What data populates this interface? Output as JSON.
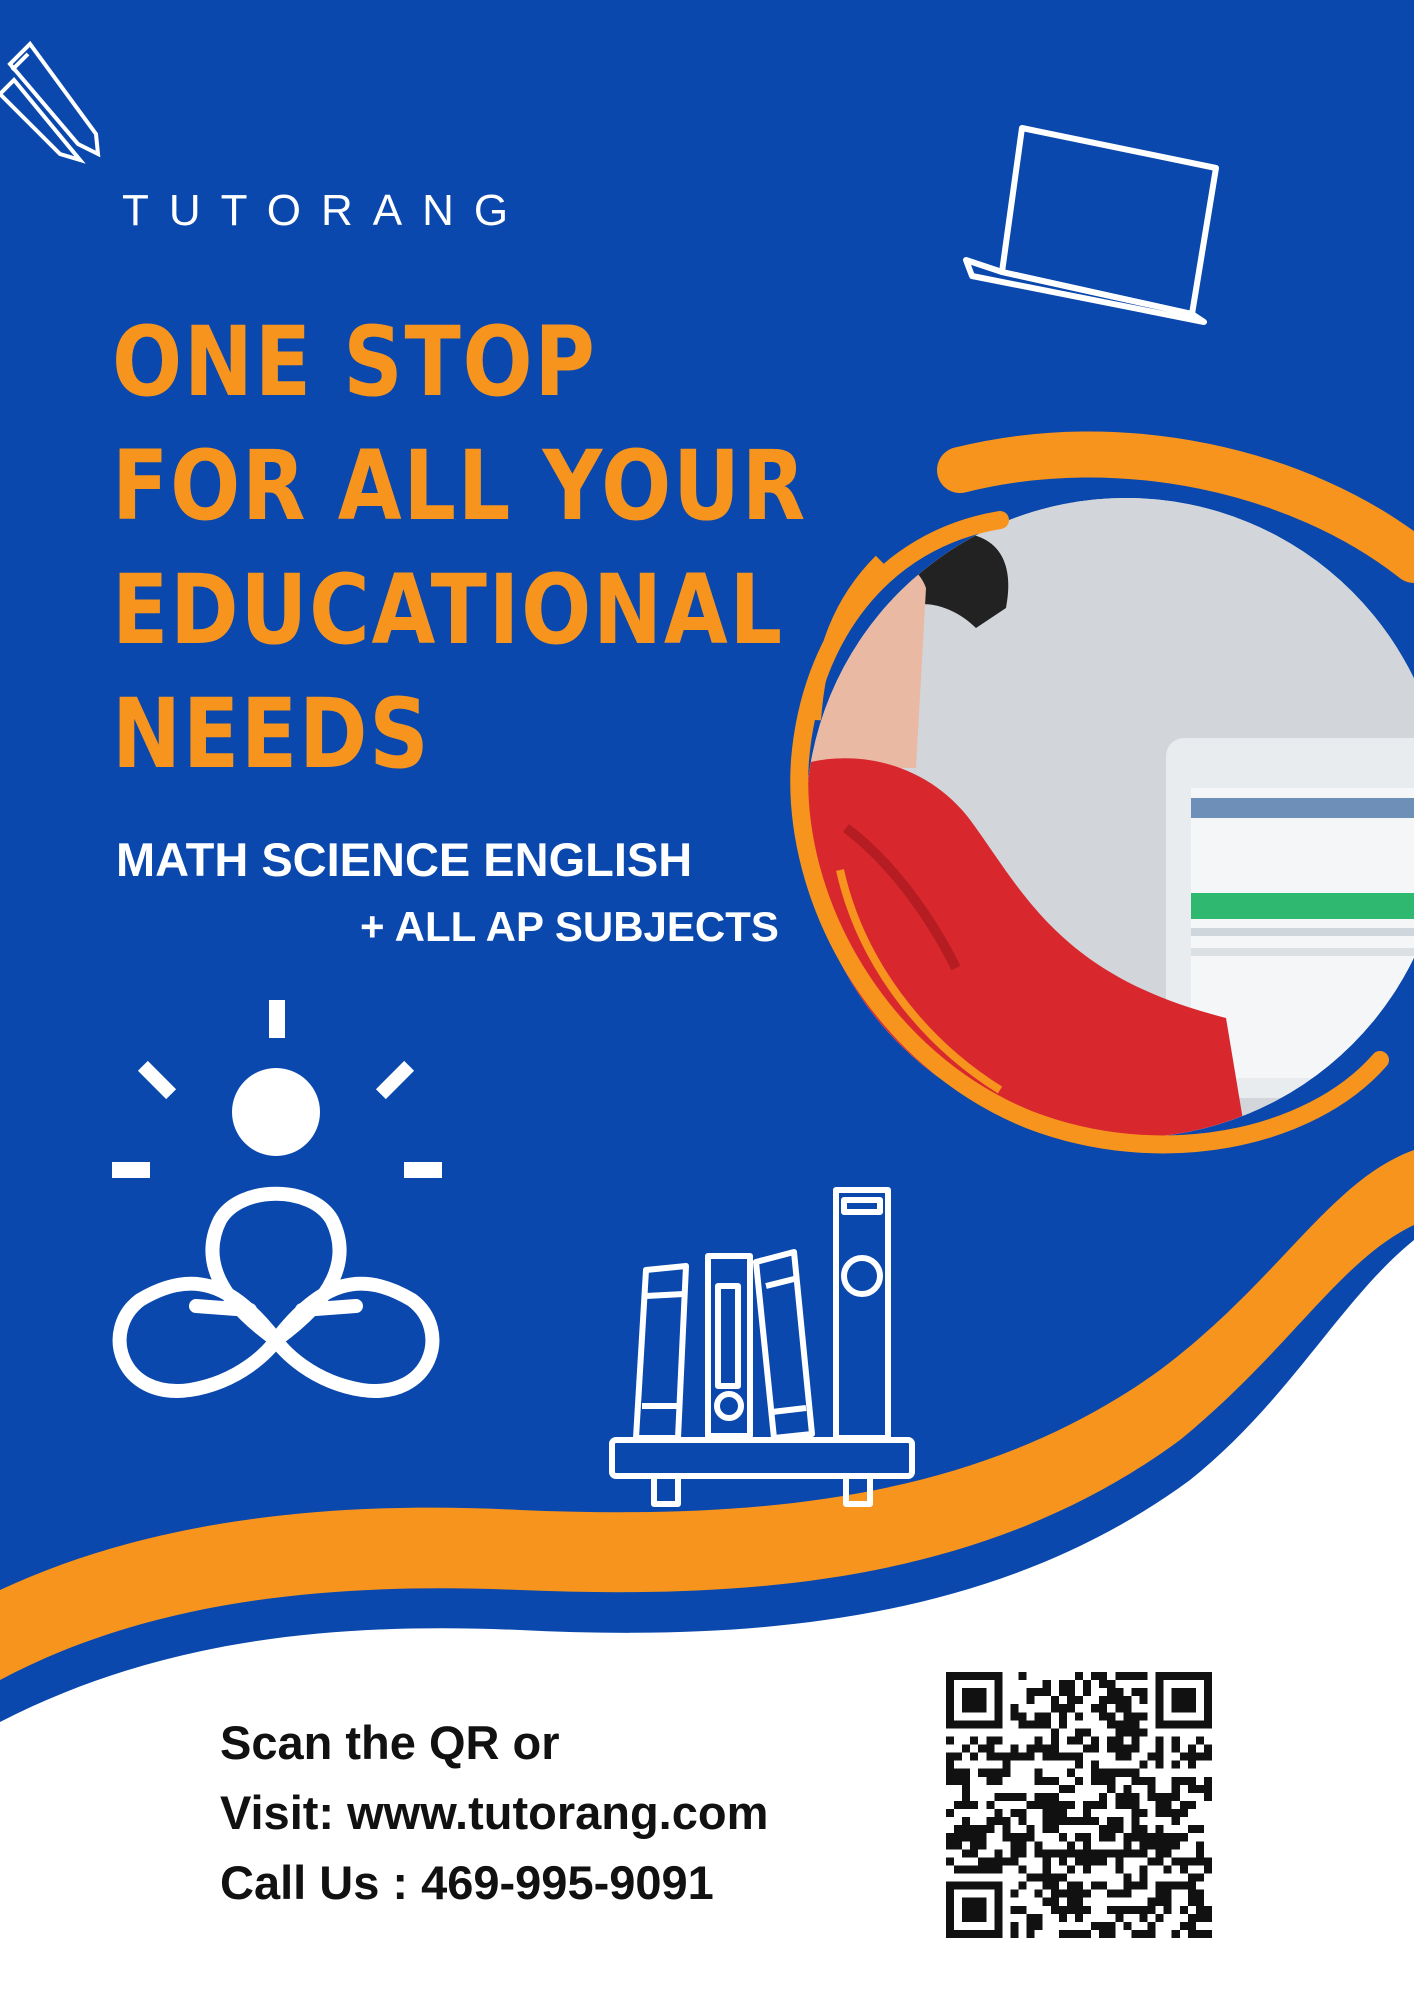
{
  "brand": {
    "name": "TUTORANG"
  },
  "headline": {
    "line1": "ONE STOP",
    "line2": "FOR ALL YOUR",
    "line3": "EDUCATIONAL",
    "line4": "NEEDS"
  },
  "subjects": {
    "main": "MATH SCIENCE ENGLISH",
    "extra": "+ ALL AP SUBJECTS"
  },
  "contact": {
    "line1": "Scan the QR or",
    "line2": "Visit: www.tutorang.com",
    "line3": "Call Us : 469-995-9091"
  },
  "colors": {
    "background_blue": "#0a48ad",
    "accent_orange": "#f7941d",
    "text_white": "#ffffff",
    "text_dark": "#111111"
  },
  "icons": [
    "pencils-icon",
    "laptop-icon",
    "meditation-lightbulb-icon",
    "books-shelf-icon",
    "qr-code-icon"
  ]
}
